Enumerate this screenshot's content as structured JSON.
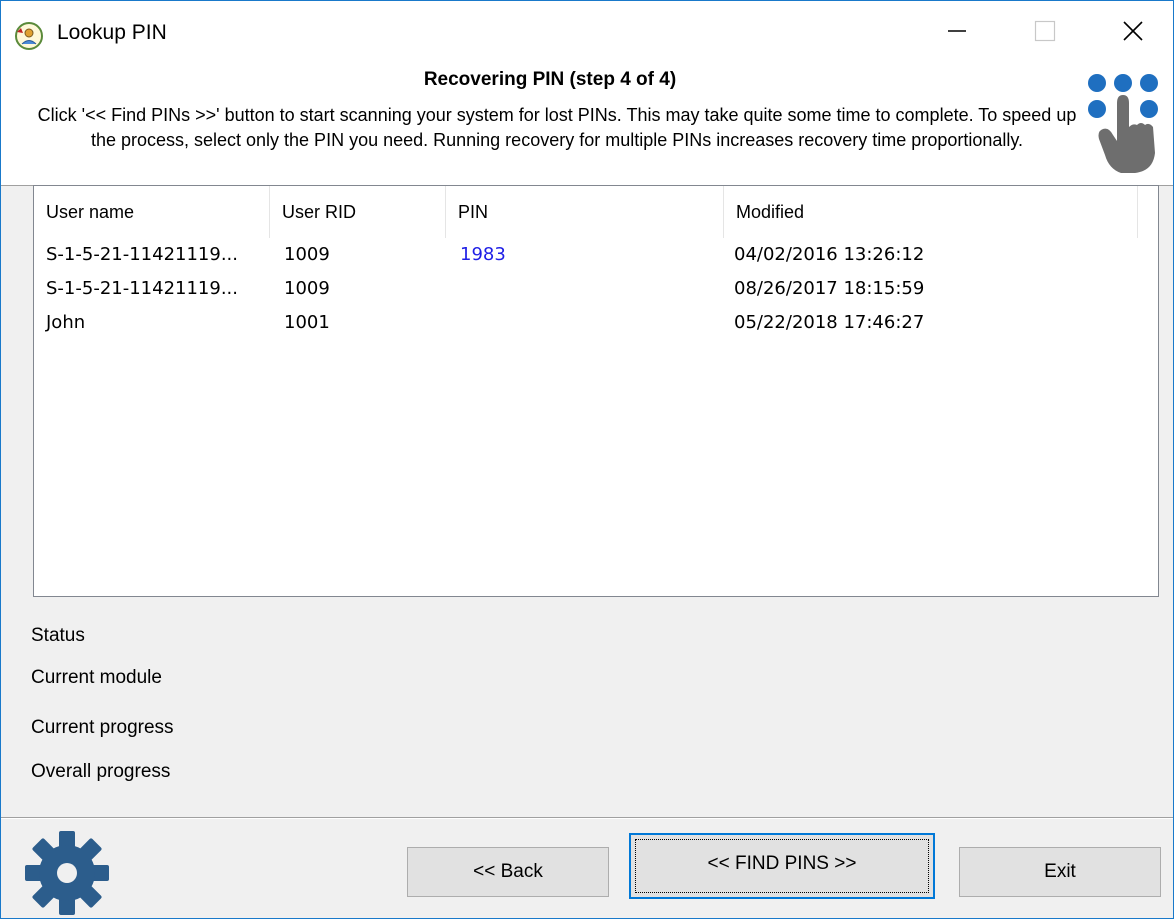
{
  "window": {
    "title": "Lookup PIN",
    "icon": "lookup-pin-app-icon"
  },
  "header": {
    "step_title": "Recovering PIN (step 4 of 4)",
    "description": "Click '<< Find PINs >>' button to start scanning your system for lost PINs. This may take quite some time to complete. To speed up the process, select only the PIN you need. Running recovery for multiple PINs increases recovery time proportionally."
  },
  "table": {
    "columns": [
      "User name",
      "User RID",
      "PIN",
      "Modified"
    ],
    "rows": [
      {
        "user_name": "S-1-5-21-11421119...",
        "user_rid": "1009",
        "pin": "1983",
        "modified": "04/02/2016 13:26:12"
      },
      {
        "user_name": "S-1-5-21-11421119...",
        "user_rid": "1009",
        "pin": "",
        "modified": "08/26/2017 18:15:59"
      },
      {
        "user_name": "John",
        "user_rid": "1001",
        "pin": "",
        "modified": "05/22/2018 17:46:27"
      }
    ]
  },
  "status": {
    "status_label": "Status",
    "current_module_label": "Current module",
    "current_progress_label": "Current progress",
    "overall_progress_label": "Overall progress"
  },
  "buttons": {
    "back": "<< Back",
    "find_pins": "<< FIND PINS >>",
    "exit": "Exit"
  },
  "colors": {
    "pin_found": "#1f1fe6",
    "accent": "#0078d7",
    "hand_dots": "#1f6fc0",
    "gear": "#2c5d8c"
  }
}
